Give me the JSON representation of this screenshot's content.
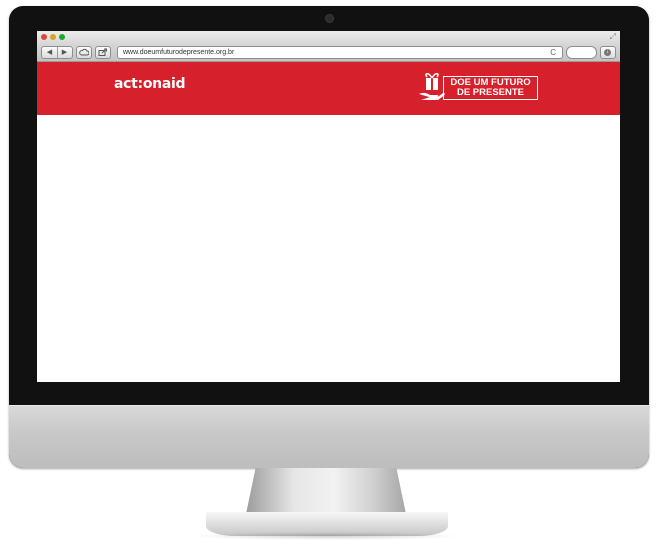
{
  "browser": {
    "url": "www.doeumfuturodepresente.org.br",
    "nav_back_glyph": "◀",
    "nav_forward_glyph": "▶",
    "reload_glyph": "C"
  },
  "site": {
    "logo": "act:onaid",
    "campaign_line1": "DOE UM FUTURO",
    "campaign_line2": "DE PRESENTE",
    "header_color": "#d6202b"
  },
  "icons": {
    "cloud": "cloud-icon",
    "share": "share-icon",
    "download": "download-icon",
    "gift": "gift-icon",
    "fullscreen": "fullscreen-icon"
  }
}
